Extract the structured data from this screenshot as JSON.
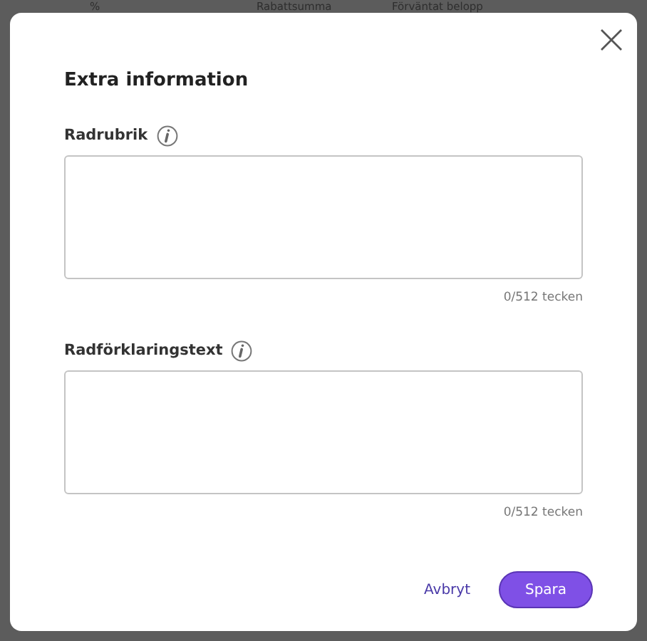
{
  "background_table": {
    "columns": [
      "%",
      "Rabattsumma",
      "Förväntat belopp"
    ]
  },
  "dialog": {
    "title": "Extra information",
    "fields": [
      {
        "label": "Radrubrik",
        "counter": "0/512 tecken"
      },
      {
        "label": "Radförklaringstext",
        "counter": "0/512 tecken"
      }
    ],
    "buttons": [
      {
        "label": "Avbryt",
        "kind": "link"
      },
      {
        "label": "Spara",
        "kind": "primary"
      }
    ]
  }
}
